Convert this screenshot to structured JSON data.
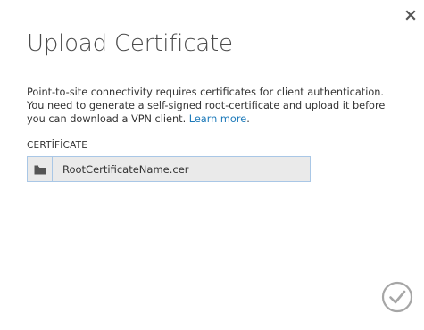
{
  "dialog": {
    "title": "Upload Certificate",
    "description_text": "Point-to-site connectivity requires certificates for client authentication. You need to generate a self-signed root-certificate and upload it before you can download a VPN client.",
    "learn_more_label": "Learn more",
    "description_end": ".",
    "certificate_label": "CERTİFİCATE",
    "certificate_file_name": "RootCertificateName.cer"
  },
  "icons": {
    "close": "close-icon",
    "browse": "folder-icon",
    "confirm": "checkmark-circle-icon"
  },
  "colors": {
    "link": "#1c79b9",
    "field_border": "#a9c7e6",
    "field_background": "#eaeaea",
    "icon_gray": "#555555",
    "confirm_gray": "#a6a6a6"
  }
}
